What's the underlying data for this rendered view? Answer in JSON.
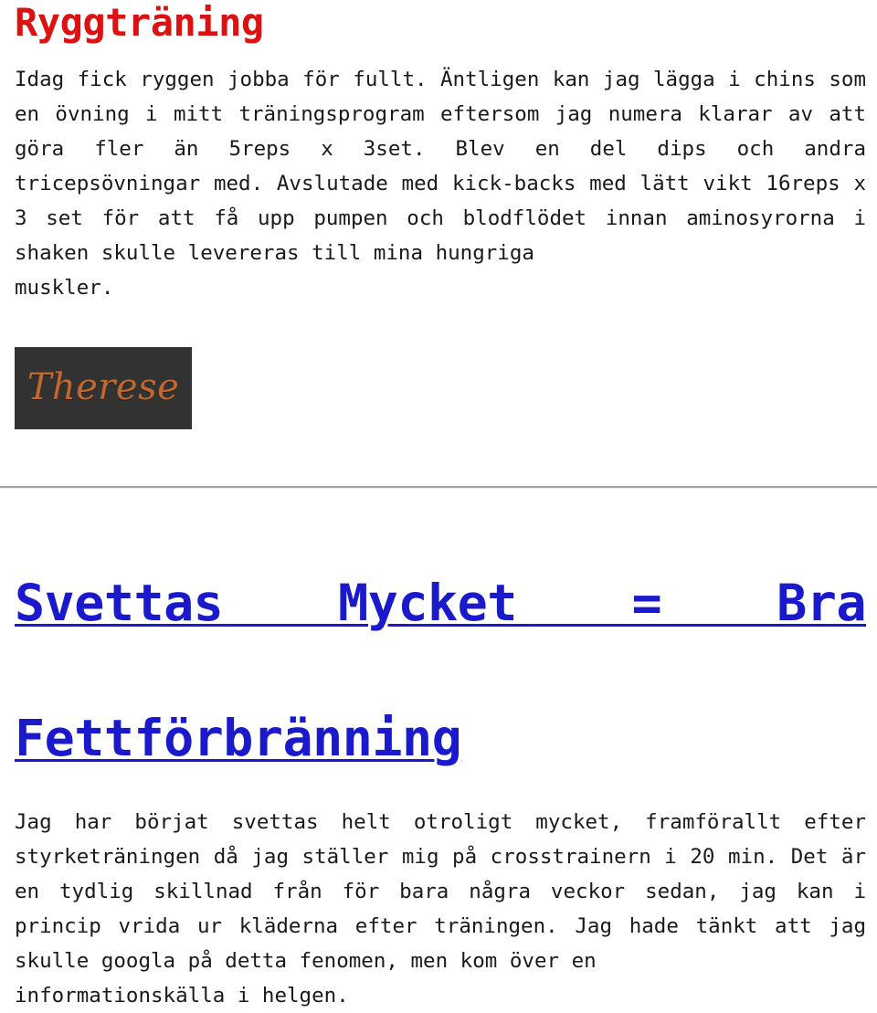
{
  "theme": {
    "background": "#ffffff",
    "title_red": "#dd1111",
    "link_blue": "#1a1acc",
    "body_text": "#1a1a1a",
    "divider_gray": "#a3a3a3",
    "signature_box_bg": "#323232",
    "signature_ink": "#c2682c"
  },
  "post1": {
    "title": "Ryggträning",
    "paragraph": "Idag fick ryggen jobba för fullt. Äntligen kan jag lägga i chins som en övning i mitt träningsprogram eftersom jag numera klarar av att göra fler än 5reps x 3set. Blev en del dips och andra tricepsövningar med. Avslutade med kick-backs med lätt vikt 16reps x 3 set för att få upp pumpen och blodflödet innan aminosyrorna i shaken skulle levereras till mina hungriga",
    "paragraph_last_line": "muskler.",
    "signature_text": "Therese"
  },
  "post2": {
    "link_line1": "Svettas Mycket = Bra",
    "link_line2": "Fettförbränning",
    "paragraph": "Jag har börjat svettas helt otroligt mycket, framförallt efter styrketräningen då jag ställer mig på crosstrainern i 20 min. Det är en tydlig skillnad från för bara några veckor sedan, jag kan i princip vrida ur kläderna efter träningen. Jag hade tänkt att jag skulle googla på detta fenomen, men kom över en",
    "paragraph_last_line": "informationskälla i helgen."
  }
}
